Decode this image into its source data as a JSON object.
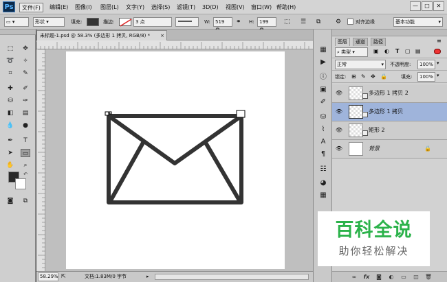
{
  "menubar": {
    "logo": "Ps",
    "items": [
      "文件(F)",
      "编辑(E)",
      "图像(I)",
      "图层(L)",
      "文字(Y)",
      "选择(S)",
      "滤镜(T)",
      "3D(D)",
      "视图(V)",
      "窗口(W)",
      "帮助(H)"
    ],
    "window_controls": [
      "—",
      "□",
      "✕"
    ]
  },
  "options": {
    "mode": "形状",
    "fill_label": "填充:",
    "stroke_label": "描边:",
    "stroke_width": "3 点",
    "w_label": "W:",
    "w_value": "519 像",
    "h_label": "H:",
    "h_value": "199 像",
    "align_edges": "对齐边缘",
    "workspace": "基本功能"
  },
  "document": {
    "tab_title": "未标题-1.psd @ 58.3% (多边形 1 拷贝, RGB/8) *",
    "tab_close": "×",
    "zoom": "58.29%",
    "doc_info": "文档:1.83M/0 字节"
  },
  "layers_panel": {
    "tabs": [
      "图层",
      "通道",
      "路径"
    ],
    "filter_kind": "类型",
    "blend_mode": "正常",
    "opacity_label": "不透明度:",
    "opacity_value": "100%",
    "lock_label": "锁定:",
    "fill_label": "填充:",
    "fill_value": "100%",
    "layers": [
      {
        "name": "多边形 1 拷贝 2",
        "selected": false
      },
      {
        "name": "多边形 1 拷贝",
        "selected": true
      },
      {
        "name": "矩形 2",
        "selected": false
      },
      {
        "name": "背景",
        "selected": false
      }
    ],
    "footer_icons": [
      "link-icon",
      "fx-icon",
      "mask-icon",
      "adjustment-icon",
      "group-icon",
      "new-layer-icon",
      "trash-icon"
    ]
  },
  "watermark": {
    "line1": "百科全说",
    "line2": "助你轻松解决"
  },
  "colors": {
    "accent_selected": "#9fb4db",
    "watermark_green": "#2bb24a",
    "envelope_stroke": "#333333"
  }
}
